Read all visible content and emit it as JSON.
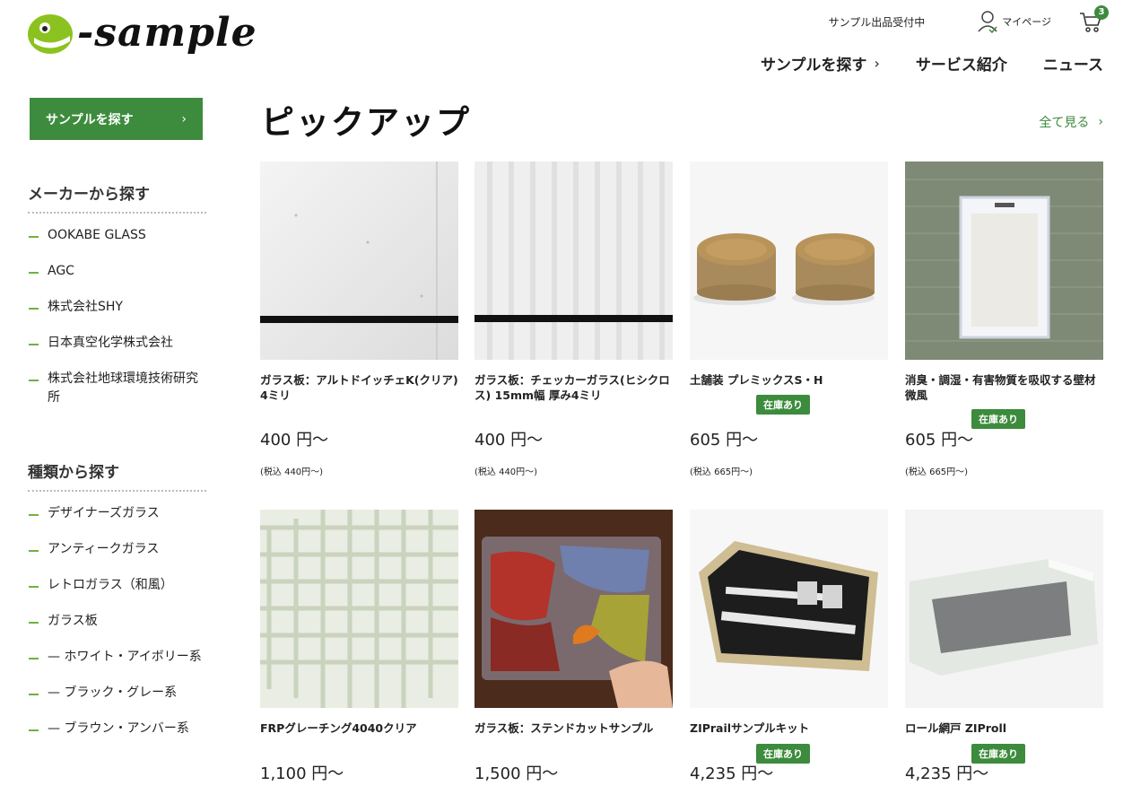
{
  "brand": {
    "logo_text": "-sample"
  },
  "header": {
    "accept_label": "サンプル出品受付中",
    "mypage_label": "マイページ",
    "cart_count": "3",
    "nav": [
      {
        "label": "サンプルを探す"
      },
      {
        "label": "サービス紹介"
      },
      {
        "label": "ニュース"
      }
    ]
  },
  "sidebar": {
    "button_label": "サンプルを探す",
    "maker_heading": "メーカーから探す",
    "makers": [
      "OOKABE GLASS",
      "AGC",
      "株式会社SHY",
      "日本真空化学株式会社",
      "株式会社地球環境技術研究所"
    ],
    "type_heading": "種類から探す",
    "types": [
      "デザイナーズガラス",
      "アンティークガラス",
      "レトロガラス（和風）",
      "ガラス板",
      "— ホワイト・アイボリー系",
      "— ブラック・グレー系",
      "— ブラウン・アンバー系"
    ]
  },
  "main": {
    "title": "ピックアップ",
    "see_all": "全て見る",
    "products": [
      {
        "name": "ガラス板：アルトドイッチェK(クリア) 4ミリ",
        "price": "400 円〜",
        "tax": "(税込 440円〜)",
        "stock": ""
      },
      {
        "name": "ガラス板：チェッカーガラス(ヒシクロス) 15mm幅 厚み4ミリ",
        "price": "400 円〜",
        "tax": "(税込 440円〜)",
        "stock": ""
      },
      {
        "name": "土舗装 プレミックスS・H",
        "price": "605 円〜",
        "tax": "(税込 665円〜)",
        "stock": "在庫あり"
      },
      {
        "name": "消臭・調湿・有害物質を吸収する壁材 微風",
        "price": "605 円〜",
        "tax": "(税込 665円〜)",
        "stock": "在庫あり"
      },
      {
        "name": "FRPグレーチング4040クリア",
        "price": "1,100 円〜",
        "tax": "",
        "stock": ""
      },
      {
        "name": "ガラス板：ステンドカットサンプル",
        "price": "1,500 円〜",
        "tax": "",
        "stock": ""
      },
      {
        "name": "ZIPrailサンプルキット",
        "price": "4,235 円〜",
        "tax": "",
        "stock": "在庫あり"
      },
      {
        "name": "ロール網戸 ZIProll",
        "price": "4,235 円〜",
        "tax": "",
        "stock": "在庫あり"
      }
    ]
  },
  "colors": {
    "accent": "#3d8b3d",
    "logo_green": "#8cc21f"
  }
}
